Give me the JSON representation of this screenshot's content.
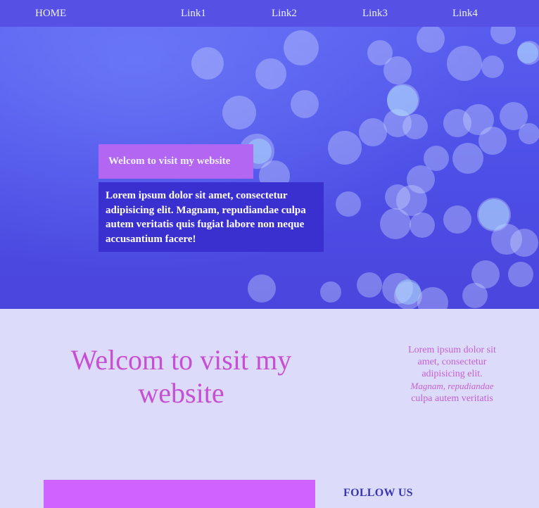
{
  "nav": {
    "home": "HOME",
    "links": [
      "Link1",
      "Link2",
      "Link3",
      "Link4"
    ]
  },
  "hero": {
    "title": "Welcom to visit my website",
    "text": "Lorem ipsum dolor sit amet, consectetur adipisicing elit. Magnam, repudiandae culpa autem veritatis quis fugiat labore non neque accusantium facere!"
  },
  "main": {
    "heading": "Welcom to visit my website",
    "side_text_1": "Lorem ipsum dolor sit amet, consectetur adipisicing elit.",
    "side_text_2": "Magnam, repudiandae",
    "side_text_3": "culpa autem veritatis"
  },
  "footer": {
    "follow": "FOLLOW US"
  },
  "colors": {
    "nav_bg": "#5650e4",
    "hero_title_bg": "#b266f2",
    "hero_text_bg": "#3a2fcf",
    "page_bg": "#dcdcfa",
    "heading": "#c64fd3",
    "footer_bar": "#d062ff",
    "follow": "#3b36b0"
  }
}
